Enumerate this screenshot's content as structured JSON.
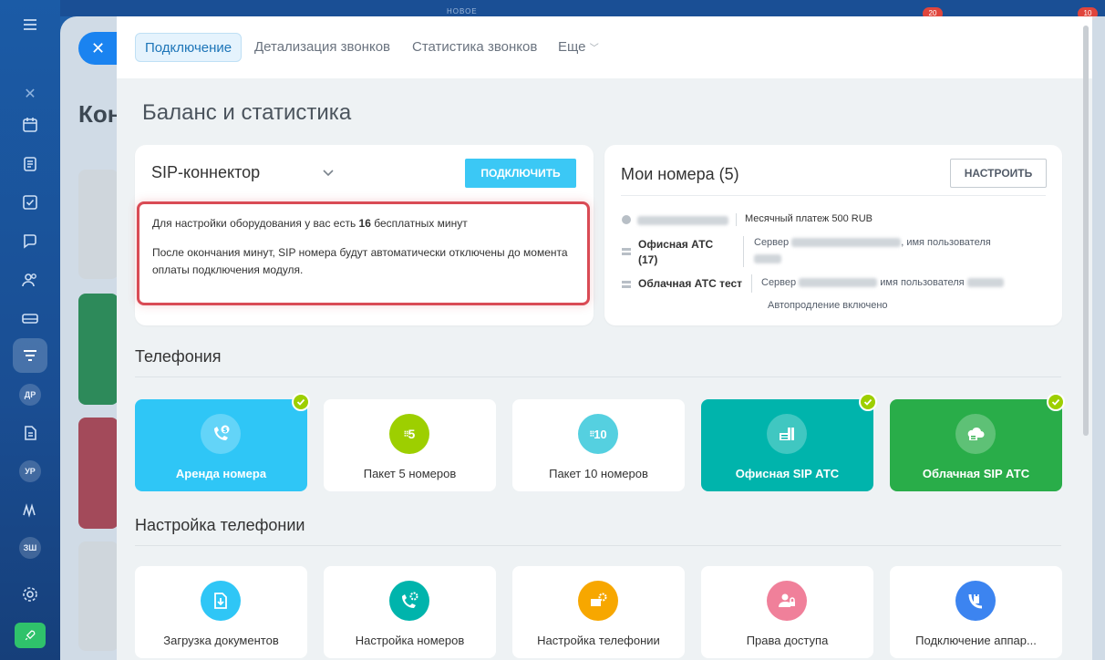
{
  "top": {
    "new_label": "НОВОЕ",
    "badge_1": "20",
    "badge_2": "10"
  },
  "rail": {
    "badge_dr": "ДР",
    "badge_ur": "УР",
    "badge_zsh": "ЗШ"
  },
  "background": {
    "title": "Кон"
  },
  "tabs": [
    {
      "label": "Подключение"
    },
    {
      "label": "Детализация звонков"
    },
    {
      "label": "Статистика звонков"
    },
    {
      "label": "Еще"
    }
  ],
  "page_title": "Баланс и статистика",
  "sip": {
    "title": "SIP-коннектор",
    "connect_label": "ПОДКЛЮЧИТЬ",
    "line1_prefix": "Для настройки оборудования у вас есть ",
    "line1_minutes": "16",
    "line1_suffix": " бесплатных минут",
    "line2": "После окончания минут, SIP номера будут автоматически отключены до момента оплаты подключения модуля."
  },
  "numbers": {
    "title": "Мои номера (5)",
    "setup_label": "НАСТРОИТЬ",
    "monthly": "Месячный платеж 500 RUB",
    "office_name": "Офисная АТС (17)",
    "office_server_label": "Сервер",
    "office_user_label": "имя пользователя",
    "cloud_name": "Облачная АТС тест",
    "cloud_server_label": "Сервер",
    "cloud_user_label": "имя пользователя",
    "autorenew": "Автопродление включено"
  },
  "telephony": {
    "title": "Телефония",
    "tiles": [
      {
        "label": "Аренда номера",
        "color": "#2fc6f6"
      },
      {
        "label": "Пакет 5 номеров",
        "color": "#9dcf00"
      },
      {
        "label": "Пакет 10 номеров",
        "color": "#55d0e0"
      },
      {
        "label": "Офисная SIP АТС",
        "color": "#00b4ac"
      },
      {
        "label": "Облачная SIP АТС",
        "color": "#29ad49"
      }
    ],
    "badge_5": "5",
    "badge_10": "10"
  },
  "settings": {
    "title": "Настройка телефонии",
    "tiles": [
      {
        "label": "Загрузка документов",
        "color": "#2fc6f6"
      },
      {
        "label": "Настройка номеров",
        "color": "#00b4ac"
      },
      {
        "label": "Настройка телефонии",
        "color": "#f7a700"
      },
      {
        "label": "Права доступа",
        "color": "#f0809a"
      },
      {
        "label": "Подключение аппар...",
        "color": "#3c84f0"
      }
    ]
  }
}
